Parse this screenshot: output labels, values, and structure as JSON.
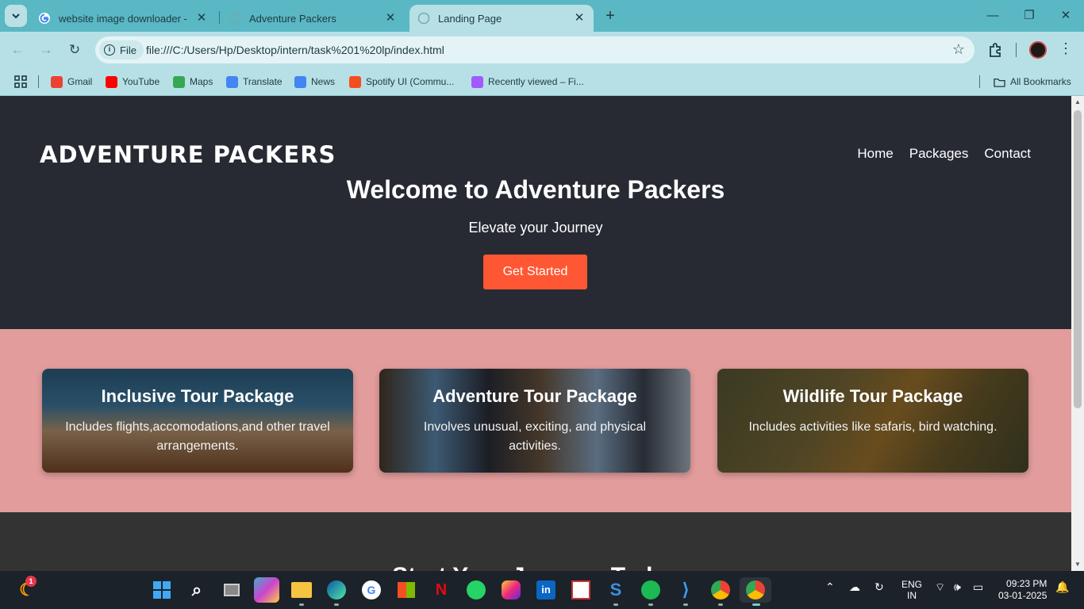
{
  "browser": {
    "tabs": [
      {
        "title": "website image downloader - Go",
        "active": false,
        "icon": "google-icon"
      },
      {
        "title": "Adventure Packers",
        "active": false,
        "icon": "globe-icon"
      },
      {
        "title": "Landing Page",
        "active": true,
        "icon": "globe-icon"
      }
    ],
    "address": {
      "chip": "File",
      "url": "file:///C:/Users/Hp/Desktop/intern/task%201%20lp/index.html"
    },
    "bookmarks": [
      {
        "label": "Gmail",
        "icon": "gmail-icon",
        "color": "#ea4335"
      },
      {
        "label": "YouTube",
        "icon": "youtube-icon",
        "color": "#ff0000"
      },
      {
        "label": "Maps",
        "icon": "maps-icon",
        "color": "#34a853"
      },
      {
        "label": "Translate",
        "icon": "translate-icon",
        "color": "#4285f4"
      },
      {
        "label": "News",
        "icon": "news-icon",
        "color": "#4285f4"
      },
      {
        "label": "Spotify UI (Commu...",
        "icon": "figma-icon",
        "color": "#f24e1e"
      },
      {
        "label": "Recently viewed – Fi...",
        "icon": "figma-icon",
        "color": "#a259ff"
      }
    ],
    "all_bookmarks": "All Bookmarks"
  },
  "page": {
    "logo": "ADVENTURE PACKERS",
    "nav": [
      "Home",
      "Packages",
      "Contact"
    ],
    "hero_title": "Welcome to Adventure Packers",
    "hero_subtitle": "Elevate your Journey",
    "cta": "Get Started",
    "packages": [
      {
        "title": "Inclusive Tour Package",
        "text": "Includes flights,accomodations,and other travel arrangements."
      },
      {
        "title": "Adventure Tour Package",
        "text": "Involves unusual, exciting, and physical activities."
      },
      {
        "title": "Wildlife Tour Package",
        "text": "Includes activities like safaris, bird watching."
      }
    ],
    "start_title": "Start Your Journey Today"
  },
  "taskbar": {
    "lang": "ENG",
    "region": "IN",
    "time": "09:23 PM",
    "date": "03-01-2025",
    "badge": "1"
  },
  "colors": {
    "hero_bg": "#272a33",
    "cta": "#ff5733",
    "packages_bg": "#e29c9c",
    "tab_bar": "#5ab7c4"
  }
}
